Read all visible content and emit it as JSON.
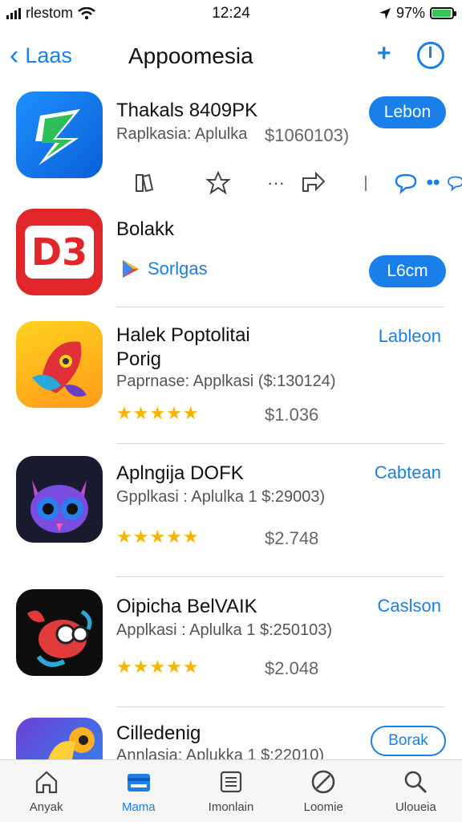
{
  "status_bar": {
    "carrier": "rlestom",
    "time": "12:24",
    "battery": "97%",
    "battery_level": 0.97
  },
  "nav": {
    "back_label": "Laas",
    "title": "Appoomesia",
    "plus_label": "+"
  },
  "apps": [
    {
      "name": "Thakals 8409PK",
      "subtitle": "Raplkasia: Aplulka",
      "price": "$1060103)",
      "button": "Lebon",
      "button_style": "filled"
    },
    {
      "name": "Bolakk",
      "link_label": "Sorlgas",
      "button": "L6cm",
      "button_style": "filled"
    },
    {
      "name": "Halek Poptolitai",
      "name_line2": "Porig",
      "subtitle": "Paprnase: Applkasi ($:130124)",
      "stars": "★★★★★",
      "rating": 5,
      "price": "$1.036",
      "button": "Lableon",
      "button_style": "link"
    },
    {
      "name": "Aplngija DOFK",
      "subtitle": "Gpplkasi : Aplulka 1 $:29003)",
      "stars": "★★★★★",
      "rating": 4.5,
      "price": "$2.748",
      "button": "Cabtean",
      "button_style": "link"
    },
    {
      "name": "Oipicha BelVAIK",
      "subtitle": "Applkasi : Aplulka 1 $:250103)",
      "stars": "★★★★★",
      "rating": 4.5,
      "price": "$2.048",
      "button": "Caslson",
      "button_style": "link"
    },
    {
      "name": "Cilledenig",
      "subtitle": "Annlasia: Aplukka 1 $:22010)",
      "button": "Borak",
      "button_style": "outline"
    }
  ],
  "row_actions": [
    {
      "icon": "book-icon"
    },
    {
      "icon": "star-icon"
    },
    {
      "icon": "ellipsis-icon"
    },
    {
      "icon": "share-icon"
    },
    {
      "icon": "divider-icon"
    },
    {
      "icon": "comment-icon"
    },
    {
      "icon": "more-dots-icon"
    }
  ],
  "tabs": [
    {
      "label": "Anyak",
      "icon": "home-icon",
      "active": false
    },
    {
      "label": "Mama",
      "icon": "card-icon",
      "active": true
    },
    {
      "label": "Imonlain",
      "icon": "list-icon",
      "active": false
    },
    {
      "label": "Loomie",
      "icon": "slash-circle-icon",
      "active": false
    },
    {
      "label": "Uloueia",
      "icon": "search-icon",
      "active": false
    }
  ],
  "colors": {
    "accent": "#1a7fe8",
    "star": "#f4b400",
    "battery": "#34c759"
  }
}
